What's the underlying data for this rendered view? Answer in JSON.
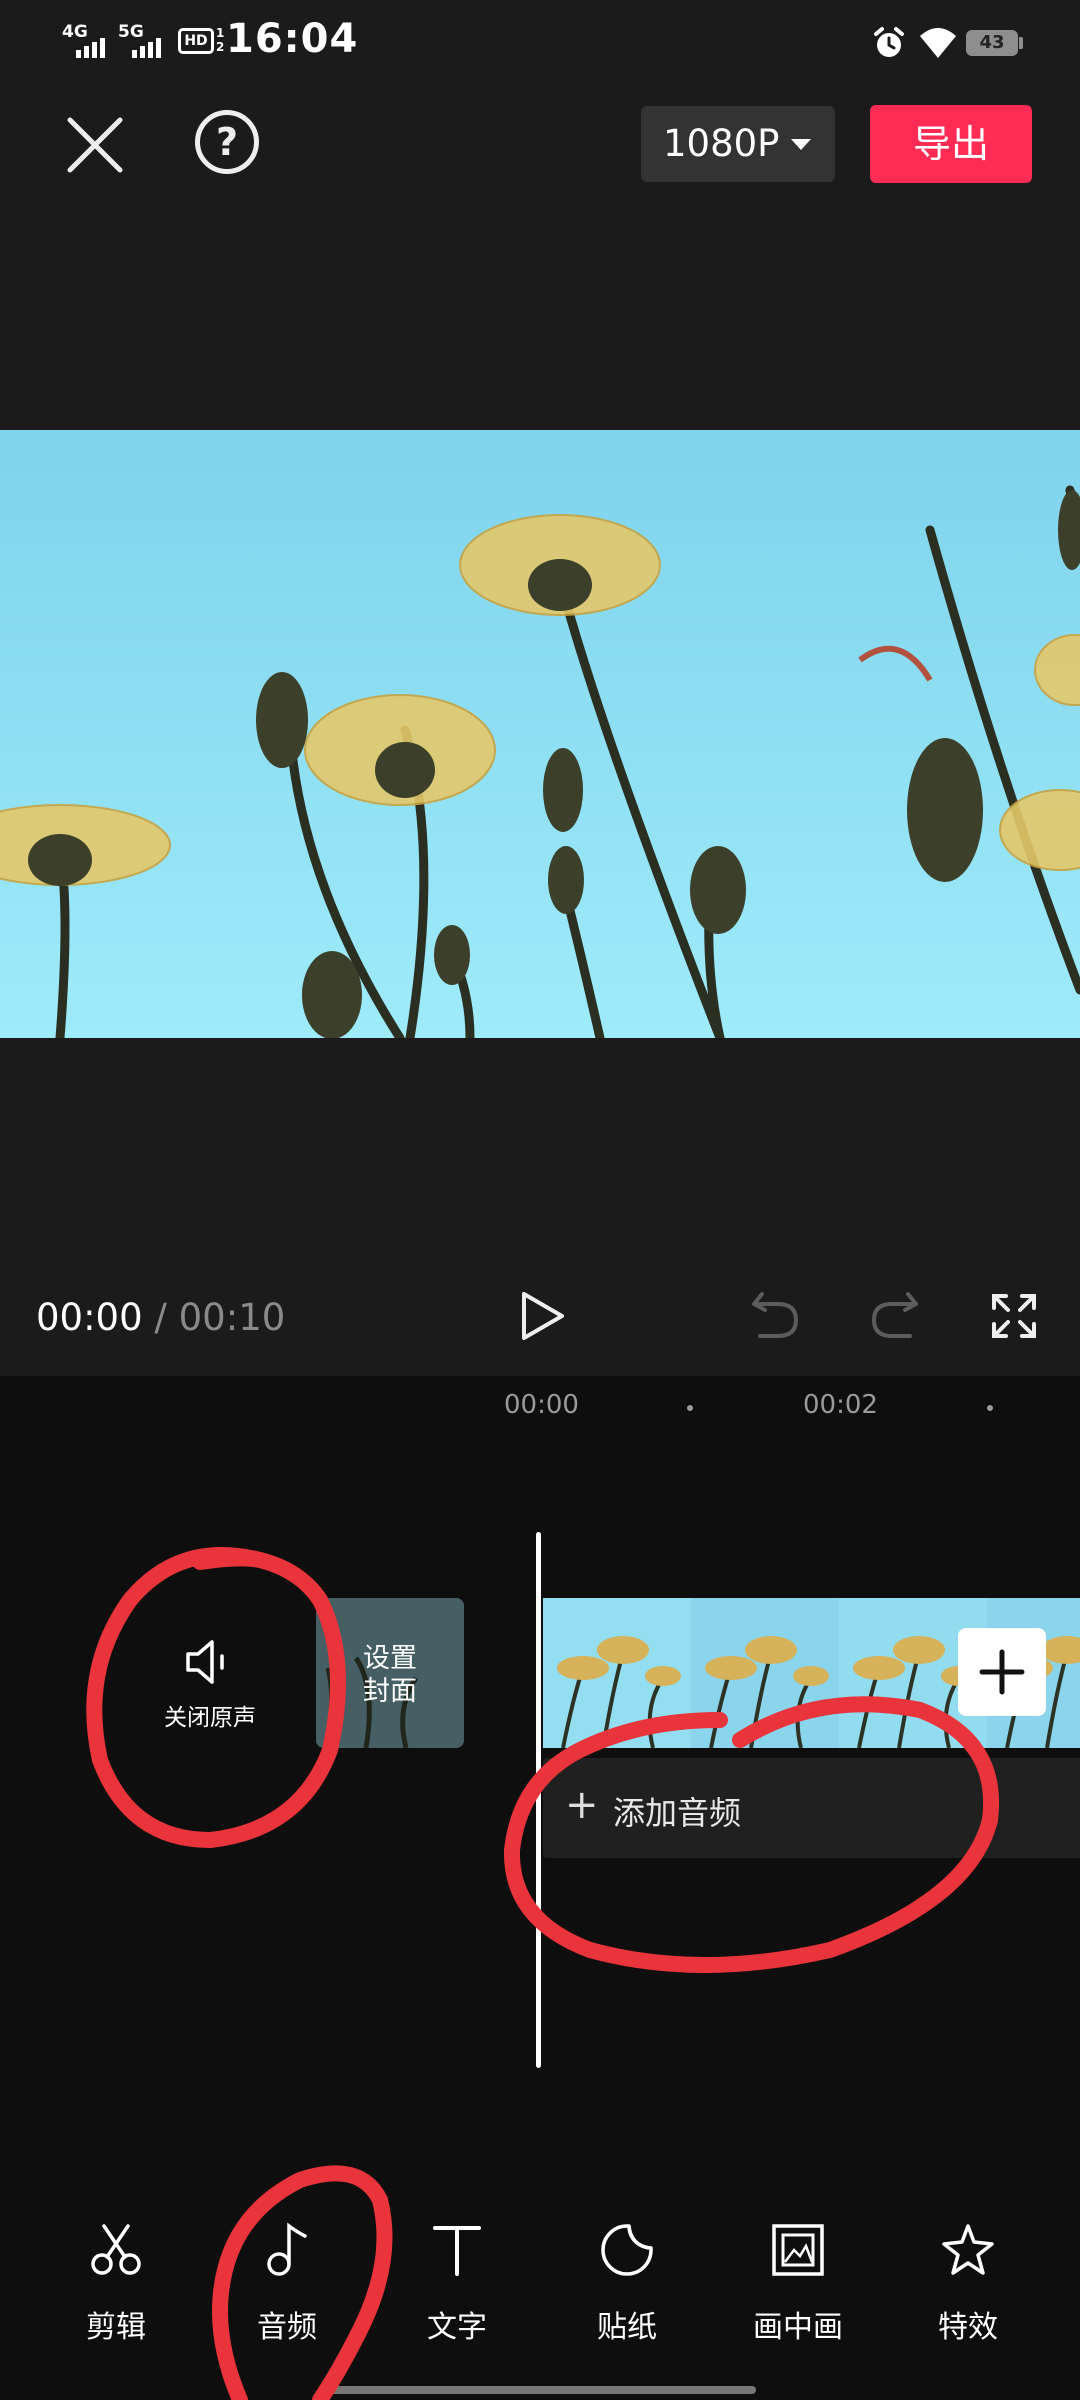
{
  "status_bar": {
    "network_1": "4G",
    "network_2": "5G",
    "hd": "HD",
    "hd_sub_1": "1",
    "hd_sub_2": "2",
    "time": "16:04",
    "battery": "43"
  },
  "top_bar": {
    "resolution": "1080P",
    "export_label": "导出"
  },
  "player": {
    "current_time": "00:00",
    "separator": "/",
    "total_time": "00:10"
  },
  "timeline": {
    "ticks": [
      "00:00",
      "00:02"
    ],
    "mute_label": "关闭原声",
    "cover_label_line1": "设置",
    "cover_label_line2": "封面",
    "add_audio_label": "添加音频"
  },
  "toolbar": {
    "items": [
      {
        "label": "剪辑",
        "icon": "scissors-icon"
      },
      {
        "label": "音频",
        "icon": "music-note-icon"
      },
      {
        "label": "文字",
        "icon": "text-icon"
      },
      {
        "label": "贴纸",
        "icon": "sticker-icon"
      },
      {
        "label": "画中画",
        "icon": "picture-in-picture-icon"
      },
      {
        "label": "特效",
        "icon": "effects-star-icon"
      }
    ]
  },
  "colors": {
    "accent": "#fe2c55",
    "annotation": "#e8343a",
    "background": "#1b1b1b"
  }
}
